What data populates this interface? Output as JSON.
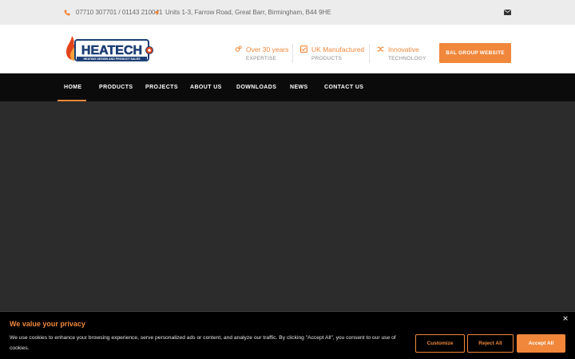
{
  "topbar": {
    "phone": "07710 307701 / 01143 210041",
    "address": "Units 1-3, Farrow Road, Great Barr, Birmingham, B44 9HE",
    "phone_icon": "phone-icon",
    "address_icon": "location-arrow-icon",
    "mail_icon": "envelope-icon"
  },
  "logo": {
    "wordmark": "HEATECH",
    "tagline": "HEATING DESIGN AND PRODUCT SALES"
  },
  "features": [
    {
      "icon": "gears-icon",
      "title": "Over 30 years",
      "subtitle": "EXPERTISE"
    },
    {
      "icon": "check-square-icon",
      "title": "UK Manufactured",
      "subtitle": "PRODUCTS"
    },
    {
      "icon": "shuffle-icon",
      "title": "Innovative",
      "subtitle": "TECHNOLOGY"
    }
  ],
  "header_button": "BAL GROUP WEBSITE",
  "nav": {
    "items": [
      "HOME",
      "PRODUCTS",
      "PROJECTS",
      "ABOUT US",
      "DOWNLOADS",
      "NEWS",
      "CONTACT US"
    ],
    "active": "HOME"
  },
  "cookie": {
    "title": "We value your privacy",
    "text": "We use cookies to enhance your browsing experience, serve personalized ads or content, and analyze our traffic. By clicking \"Accept All\", you consent to our use of cookies.",
    "customize": "Customize",
    "reject": "Reject All",
    "accept": "Accept All",
    "close_icon": "close-icon"
  },
  "colors": {
    "accent": "#f0873b",
    "nav_bg": "#0b0b0b",
    "topbar_bg": "#ececec",
    "hero_bg": "#2c2c2c"
  }
}
